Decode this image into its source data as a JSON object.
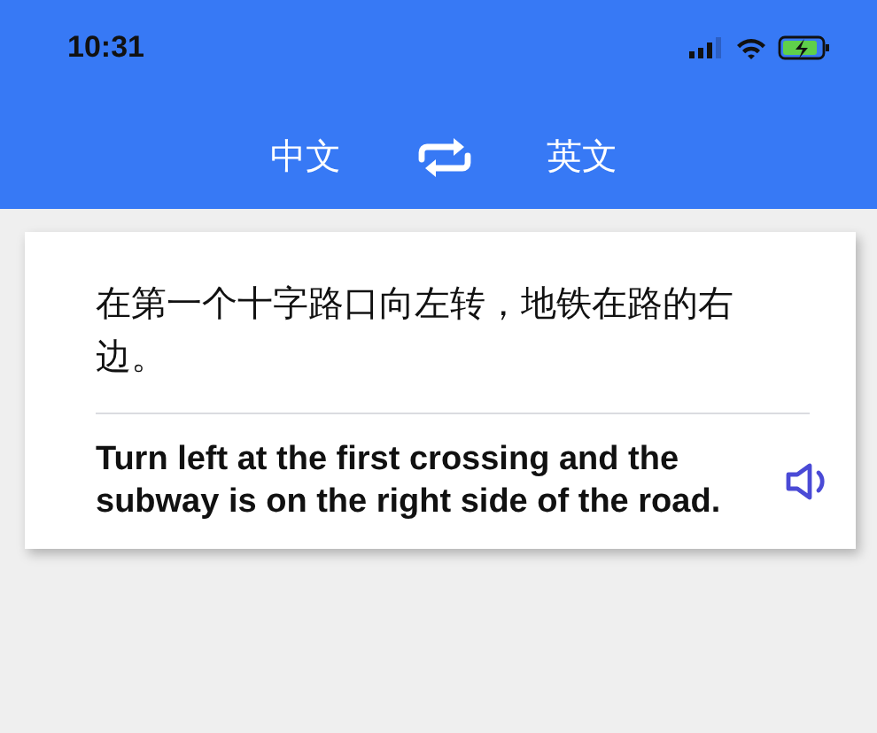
{
  "status_bar": {
    "time": "10:31"
  },
  "language_bar": {
    "source": "中文",
    "target": "英文"
  },
  "card": {
    "source_text": "在第一个十字路口向左转，地铁在路的右边。",
    "translation": "Turn left at the first crossing and the subway is on the right side of the road."
  }
}
